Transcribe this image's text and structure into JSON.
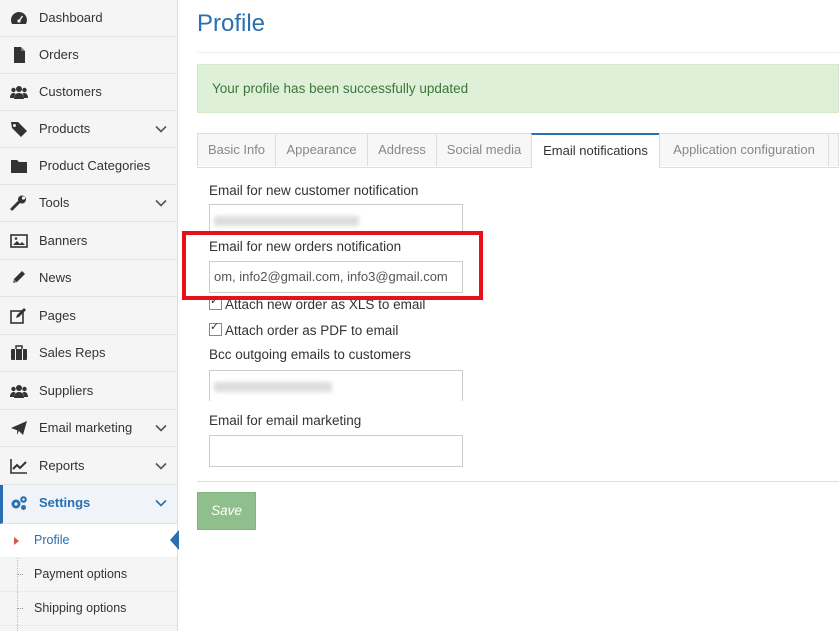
{
  "sidebar": {
    "items": [
      {
        "label": "Dashboard",
        "icon": "dashboard-icon",
        "has_chevron": false
      },
      {
        "label": "Orders",
        "icon": "file-icon",
        "has_chevron": false
      },
      {
        "label": "Customers",
        "icon": "users-icon",
        "has_chevron": false
      },
      {
        "label": "Products",
        "icon": "tag-icon",
        "has_chevron": true
      },
      {
        "label": "Product Categories",
        "icon": "folder-icon",
        "has_chevron": false
      },
      {
        "label": "Tools",
        "icon": "wrench-icon",
        "has_chevron": true
      },
      {
        "label": "Banners",
        "icon": "image-icon",
        "has_chevron": false
      },
      {
        "label": "News",
        "icon": "pencil-icon",
        "has_chevron": false
      },
      {
        "label": "Pages",
        "icon": "edit-icon",
        "has_chevron": false
      },
      {
        "label": "Sales Reps",
        "icon": "briefcase-icon",
        "has_chevron": false
      },
      {
        "label": "Suppliers",
        "icon": "users-icon",
        "has_chevron": false
      },
      {
        "label": "Email marketing",
        "icon": "paper-plane-icon",
        "has_chevron": true
      },
      {
        "label": "Reports",
        "icon": "line-chart-icon",
        "has_chevron": true
      },
      {
        "label": "Settings",
        "icon": "gears-icon",
        "has_chevron": true,
        "active": true
      }
    ],
    "subitems": [
      {
        "label": "Profile",
        "current": true
      },
      {
        "label": "Payment options",
        "current": false
      },
      {
        "label": "Shipping options",
        "current": false
      }
    ]
  },
  "page": {
    "title": "Profile",
    "alert": "Your profile has been successfully updated"
  },
  "tabs": [
    "Basic Info",
    "Appearance",
    "Address",
    "Social media",
    "Email notifications",
    "Application configuration"
  ],
  "active_tab": "Email notifications",
  "form": {
    "new_customer_label": "Email for new customer notification",
    "new_orders_label": "Email for new orders notification",
    "new_orders_value": "om, info2@gmail.com, info3@gmail.com",
    "attach_xls_label": "Attach new order as XLS to email",
    "attach_pdf_label": "Attach order as PDF to email",
    "bcc_label": "Bcc outgoing emails to customers",
    "marketing_label": "Email for email marketing",
    "marketing_value": "",
    "save_label": "Save"
  },
  "colors": {
    "accent": "#2a6fb0",
    "alert_bg": "#dff0d8",
    "alert_text": "#3c763d",
    "save_bg": "#8fbf8c",
    "highlight": "#e8101a"
  }
}
